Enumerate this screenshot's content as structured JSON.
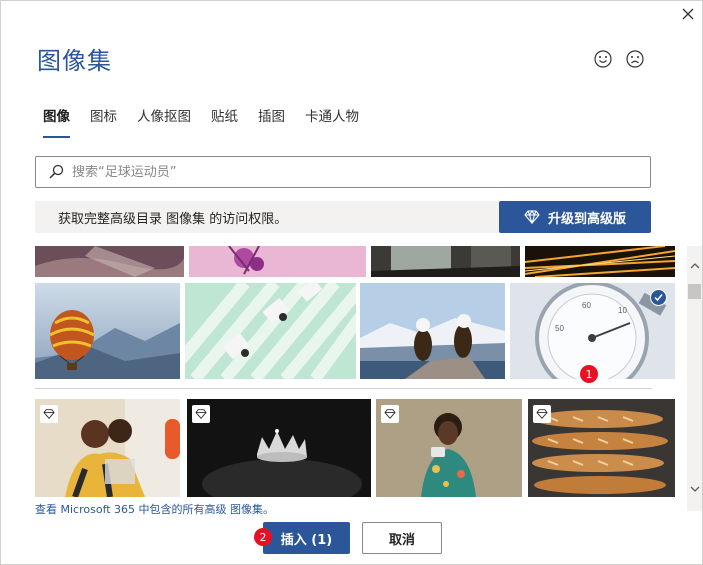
{
  "dialog": {
    "title": "图像集",
    "close_icon": "close-icon",
    "feedback": {
      "happy_icon": "smile-icon",
      "sad_icon": "frown-icon"
    }
  },
  "tabs": [
    {
      "label": "图像",
      "active": true
    },
    {
      "label": "图标",
      "active": false
    },
    {
      "label": "人像抠图",
      "active": false
    },
    {
      "label": "贴纸",
      "active": false
    },
    {
      "label": "插图",
      "active": false
    },
    {
      "label": "卡通人物",
      "active": false
    }
  ],
  "search": {
    "placeholder": "搜索“足球运动员”",
    "value": "",
    "icon": "search-icon"
  },
  "promo": {
    "text": "获取完整高级目录 图像集 的访问权限。",
    "upgrade_label": "升级到高级版",
    "upgrade_icon": "diamond-icon"
  },
  "gallery": {
    "top_row_partial": [
      "hand-with-phone",
      "pink-flowers",
      "car-window-view",
      "light-trails"
    ],
    "free_row": [
      {
        "subject": "hot-air-balloon",
        "selected": false
      },
      {
        "subject": "aerial-office-desks",
        "selected": false
      },
      {
        "subject": "two-eagles",
        "selected": false
      },
      {
        "subject": "stopwatch",
        "selected": true
      }
    ],
    "premium_row": [
      {
        "subject": "embracing-people",
        "premium": true
      },
      {
        "subject": "crown-on-pillow",
        "premium": true
      },
      {
        "subject": "woman-in-floral-dress",
        "premium": true
      },
      {
        "subject": "baguettes",
        "premium": true
      }
    ],
    "premium_badge_icon": "diamond-icon",
    "check_icon": "checkmark-icon"
  },
  "footer_link": "查看 Microsoft 365 中包含的所有高级 图像集。",
  "buttons": {
    "insert_label": "插入 (1)",
    "cancel_label": "取消"
  },
  "annotations": {
    "step1": "1",
    "step2": "2"
  },
  "colors": {
    "accent": "#2b579a",
    "badge": "#e81123"
  }
}
